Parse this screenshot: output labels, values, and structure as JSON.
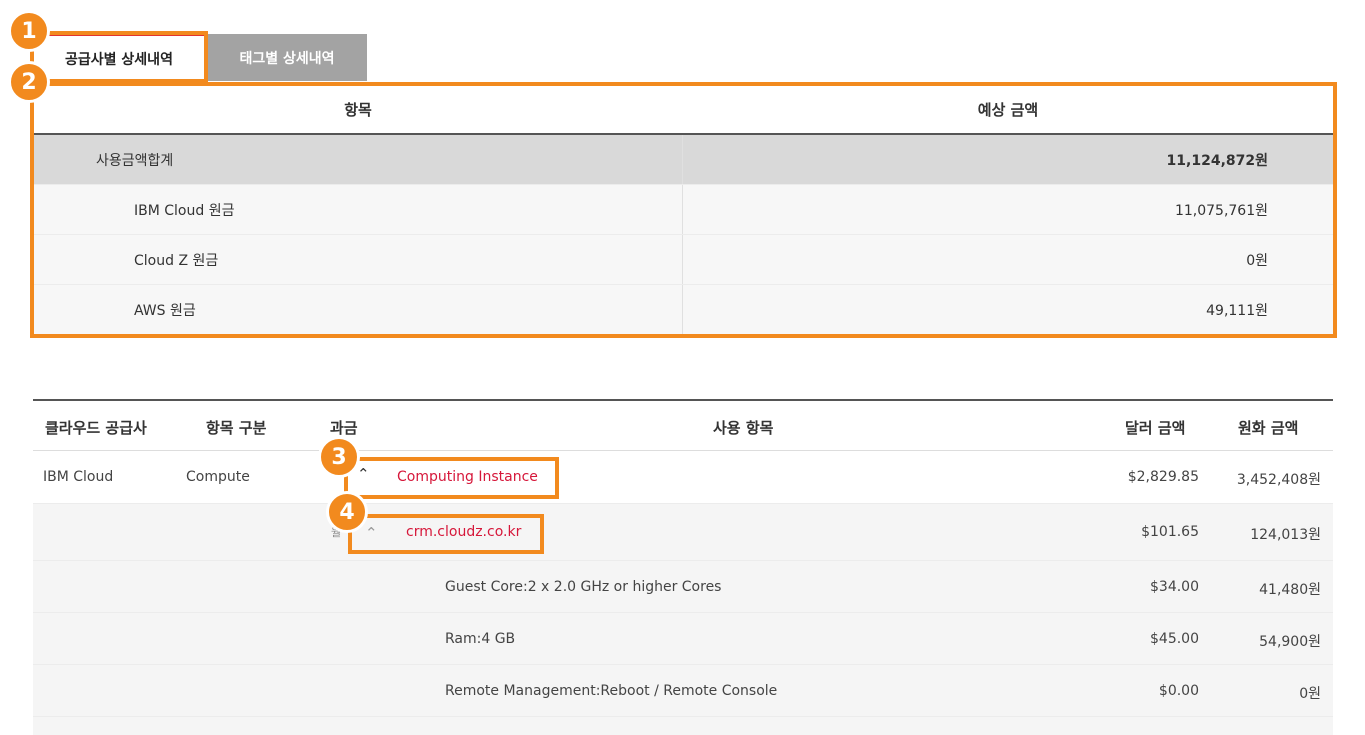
{
  "tabs": [
    {
      "label": "공급사별 상세내역"
    },
    {
      "label": "태그별 상세내역"
    }
  ],
  "summary": {
    "headers": {
      "item": "항목",
      "amount": "예상 금액"
    },
    "total": {
      "label": "사용금액합계",
      "amount": "11,124,872원"
    },
    "rows": [
      {
        "label": "IBM Cloud 원금",
        "amount": "11,075,761원"
      },
      {
        "label": "Cloud Z 원금",
        "amount": "0원"
      },
      {
        "label": "AWS 원금",
        "amount": "49,111원"
      }
    ]
  },
  "detail": {
    "headers": {
      "provider": "클라우드 공급사",
      "category": "항목 구분",
      "billing": "과금",
      "usage": "사용 항목",
      "usd": "달러 금액",
      "krw": "원화 금액"
    },
    "instance_row": {
      "provider": "IBM Cloud",
      "category": "Compute",
      "item": "Computing Instance",
      "usd": "$2,829.85",
      "krw": "3,452,408원"
    },
    "host_row": {
      "item": "crm.cloudz.co.kr",
      "usd": "$101.65",
      "krw": "124,013원",
      "partial_label": "월"
    },
    "spec_rows": [
      {
        "item": "Guest Core:2 x 2.0 GHz or higher Cores",
        "usd": "$34.00",
        "krw": "41,480원"
      },
      {
        "item": "Ram:4 GB",
        "usd": "$45.00",
        "krw": "54,900원"
      },
      {
        "item": "Remote Management:Reboot / Remote Console",
        "usd": "$0.00",
        "krw": "0원"
      }
    ]
  },
  "annotations": [
    "1",
    "2",
    "3",
    "4"
  ],
  "colors": {
    "highlight": "#f28a1e",
    "link": "#d6173a",
    "active_tab_border": "#e3342f",
    "inactive_tab": "#a3a3a3"
  }
}
